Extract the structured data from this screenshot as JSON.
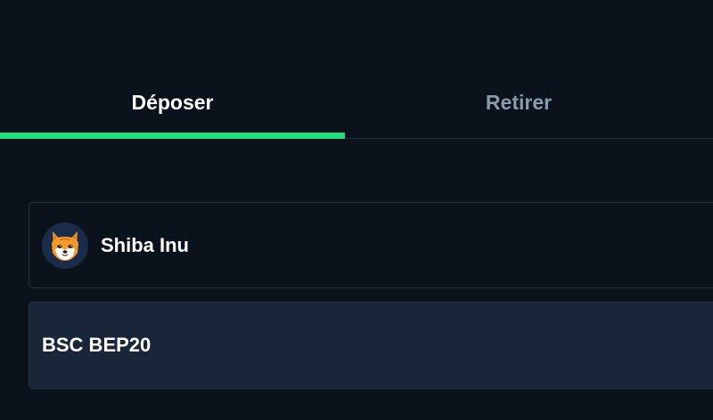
{
  "tabs": {
    "deposit_label": "Déposer",
    "withdraw_label": "Retirer"
  },
  "coin": {
    "name": "Shiba Inu",
    "icon": "shiba-inu-icon"
  },
  "network": {
    "name": "BSC BEP20"
  },
  "colors": {
    "background": "#0a121b",
    "accent": "#1ee07f",
    "inactive_text": "#8a9bad",
    "field_border": "#263442",
    "network_field_bg": "#19263a"
  }
}
